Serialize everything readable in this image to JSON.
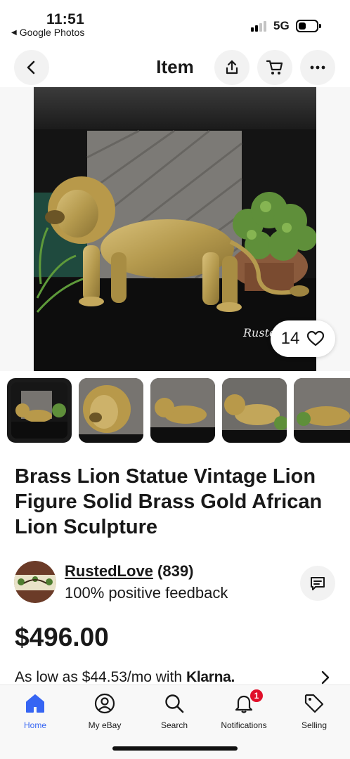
{
  "status_bar": {
    "time": "11:51",
    "back_app": "Google Photos",
    "network": "5G"
  },
  "header": {
    "title": "Item",
    "icons": [
      "back-arrow-icon",
      "share-icon",
      "cart-icon",
      "more-icon"
    ]
  },
  "gallery": {
    "watermark": "Rusted",
    "like_count": "14",
    "thumbnail_count": 5,
    "selected_thumbnail": 1
  },
  "listing": {
    "title": "Brass Lion Statue Vintage Lion Figure Solid Brass Gold African Lion Sculpture",
    "price": "$496.00",
    "financing_text": "As low as $44.53/mo with",
    "financing_provider": "Klarna."
  },
  "seller": {
    "name": "RustedLove",
    "rating_count": "(839)",
    "feedback": "100% positive feedback"
  },
  "bottom_nav": {
    "items": [
      {
        "label": "Home",
        "icon": "home-icon",
        "active": true
      },
      {
        "label": "My eBay",
        "icon": "user-icon",
        "active": false
      },
      {
        "label": "Search",
        "icon": "search-icon",
        "active": false
      },
      {
        "label": "Notifications",
        "icon": "bell-icon",
        "active": false,
        "badge": "1"
      },
      {
        "label": "Selling",
        "icon": "tag-icon",
        "active": false
      }
    ]
  },
  "colors": {
    "accent_blue": "#3665f3",
    "badge_red": "#e0102a",
    "text": "#191919"
  }
}
